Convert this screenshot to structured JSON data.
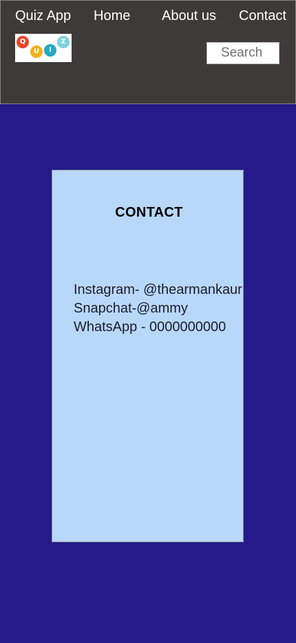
{
  "nav": {
    "brand": "Quiz App",
    "links": [
      "Home",
      "About us",
      "Contact"
    ]
  },
  "logo": {
    "letters": [
      "Q",
      "U",
      "I",
      "Z"
    ],
    "colors": [
      "#e8452c",
      "#f2b21d",
      "#25a9c4",
      "#7fd0dd"
    ]
  },
  "search": {
    "placeholder": "Search",
    "icon": "none"
  },
  "card": {
    "title": "CONTACT",
    "lines": [
      "Instagram- @thearmankaur",
      "Snapchat-@ammy",
      "WhatsApp - 0000000000"
    ]
  },
  "colors": {
    "navbar": "#3f3a3a",
    "page_background": "#241a8a",
    "card_background": "#b8d8fa"
  }
}
